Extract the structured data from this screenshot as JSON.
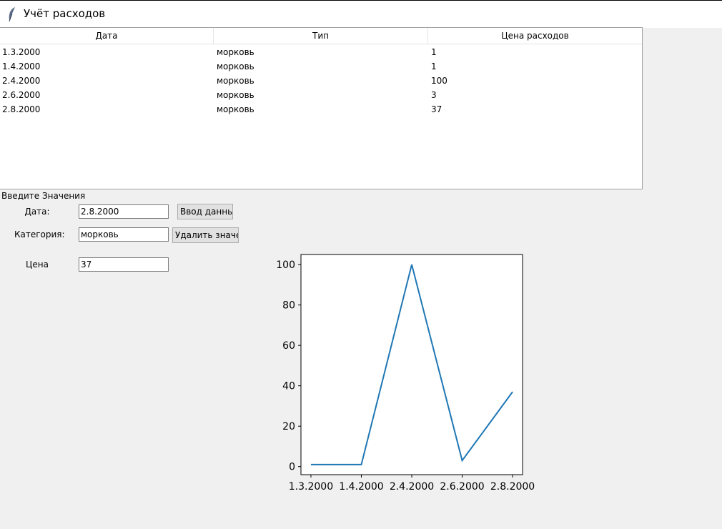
{
  "window": {
    "title": "Учёт расходов",
    "icon": "feather-icon"
  },
  "table": {
    "headers": [
      "Дата",
      "Тип",
      "Цена расходов"
    ],
    "rows": [
      [
        "1.3.2000",
        "морковь",
        "1"
      ],
      [
        "1.4.2000",
        "морковь",
        "1"
      ],
      [
        "2.4.2000",
        "морковь",
        "100"
      ],
      [
        "2.6.2000",
        "морковь",
        "3"
      ],
      [
        "2.8.2000",
        "морковь",
        "37"
      ]
    ]
  },
  "form": {
    "section_label": "Введите Значения",
    "date_label": "Дата:",
    "date_value": "2.8.2000",
    "category_label": "Категория:",
    "category_value": "морковь",
    "price_label": "Цена",
    "price_value": "37",
    "enter_button": "Ввод данных",
    "delete_button": "Удалить значен"
  },
  "chart_data": {
    "type": "line",
    "x": [
      "1.3.2000",
      "1.4.2000",
      "2.4.2000",
      "2.6.2000",
      "2.8.2000"
    ],
    "series": [
      {
        "values": [
          1,
          1,
          100,
          3,
          37
        ],
        "color": "#1f77b4"
      }
    ],
    "ylim": [
      -4,
      105
    ],
    "yticks": [
      0,
      20,
      40,
      60,
      80,
      100
    ],
    "grid": false,
    "title": "",
    "xlabel": "",
    "ylabel": ""
  }
}
